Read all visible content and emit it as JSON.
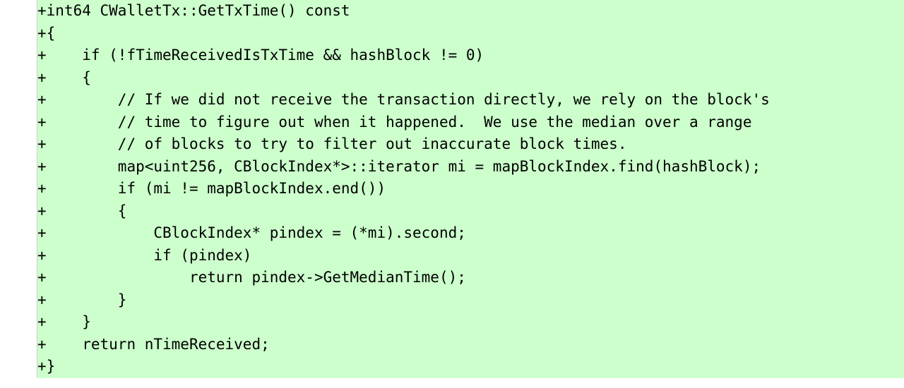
{
  "diff": {
    "marker": "+",
    "lines": [
      "int64 CWalletTx::GetTxTime() const",
      "{",
      "    if (!fTimeReceivedIsTxTime && hashBlock != 0)",
      "    {",
      "        // If we did not receive the transaction directly, we rely on the block's",
      "        // time to figure out when it happened.  We use the median over a range",
      "        // of blocks to try to filter out inaccurate block times.",
      "        map<uint256, CBlockIndex*>::iterator mi = mapBlockIndex.find(hashBlock);",
      "        if (mi != mapBlockIndex.end())",
      "        {",
      "            CBlockIndex* pindex = (*mi).second;",
      "            if (pindex)",
      "                return pindex->GetMedianTime();",
      "        }",
      "    }",
      "    return nTimeReceived;",
      "}"
    ]
  }
}
